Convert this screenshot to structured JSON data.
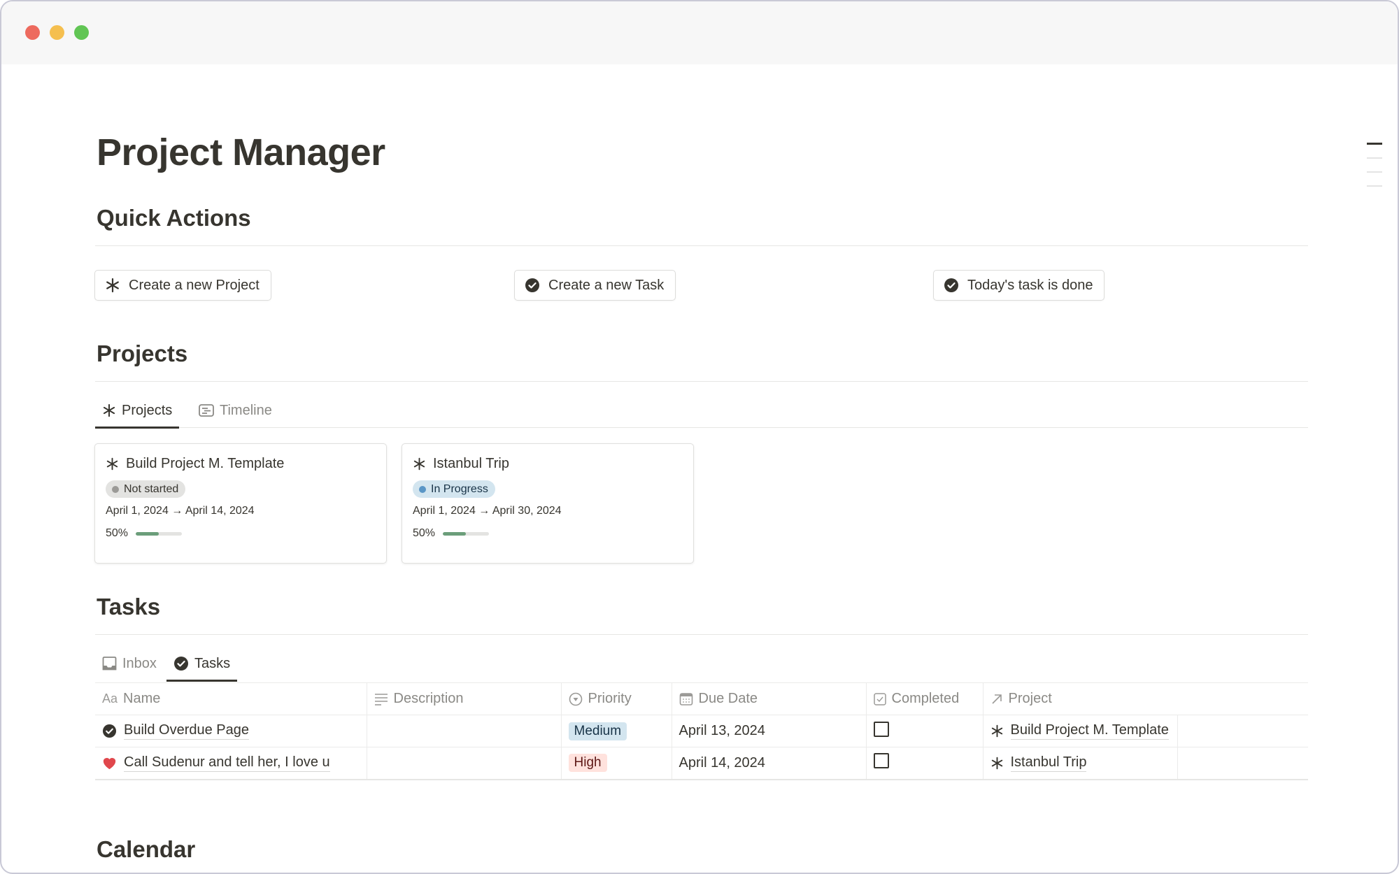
{
  "window": {
    "controls": [
      "close",
      "minimize",
      "maximize"
    ]
  },
  "page": {
    "title": "Project Manager"
  },
  "quick_actions": {
    "heading": "Quick Actions",
    "buttons": [
      {
        "label": "Create a new Project",
        "icon": "asterisk-icon"
      },
      {
        "label": "Create a new Task",
        "icon": "check-circle-icon"
      },
      {
        "label": "Today's task is done",
        "icon": "check-circle-icon"
      }
    ]
  },
  "projects": {
    "heading": "Projects",
    "tabs": [
      {
        "label": "Projects",
        "icon": "asterisk-icon",
        "active": true
      },
      {
        "label": "Timeline",
        "icon": "timeline-icon",
        "active": false
      }
    ],
    "cards": [
      {
        "title": "Build Project M. Template",
        "status": "Not started",
        "status_color": "#9b9a97",
        "status_bg": "#e3e3e1",
        "dates": "April 1, 2024 → April 14, 2024",
        "progress_label": "50%",
        "progress": 0.5
      },
      {
        "title": "Istanbul Trip",
        "status": "In Progress",
        "status_color": "#5a96c6",
        "status_bg": "#d3e5ef",
        "dates": "April 1, 2024 → April 30, 2024",
        "progress_label": "50%",
        "progress": 0.5
      }
    ]
  },
  "tasks": {
    "heading": "Tasks",
    "tabs": [
      {
        "label": "Inbox",
        "icon": "inbox-icon",
        "active": false
      },
      {
        "label": "Tasks",
        "icon": "check-circle-icon",
        "active": true
      }
    ],
    "columns": [
      {
        "label": "Name",
        "icon": "text-icon"
      },
      {
        "label": "Description",
        "icon": "lines-icon"
      },
      {
        "label": "Priority",
        "icon": "select-icon"
      },
      {
        "label": "Due Date",
        "icon": "calendar-icon"
      },
      {
        "label": "Completed",
        "icon": "checkbox-icon"
      },
      {
        "label": "Project",
        "icon": "relation-arrow-icon"
      }
    ],
    "rows": [
      {
        "name": "Build Overdue Page",
        "icon": "check-circle-icon",
        "description": "",
        "priority": "Medium",
        "priority_bg": "#d3e5ef",
        "priority_fg": "#183347",
        "due_date": "April 13, 2024",
        "completed": false,
        "project": "Build Project M. Template"
      },
      {
        "name": "Call Sudenur and tell her, I love u",
        "icon": "heart-icon",
        "description": "",
        "priority": "High",
        "priority_bg": "#ffe2dd",
        "priority_fg": "#5d1715",
        "due_date": "April 14, 2024",
        "completed": false,
        "project": "Istanbul Trip"
      }
    ]
  },
  "calendar": {
    "heading": "Calendar"
  }
}
